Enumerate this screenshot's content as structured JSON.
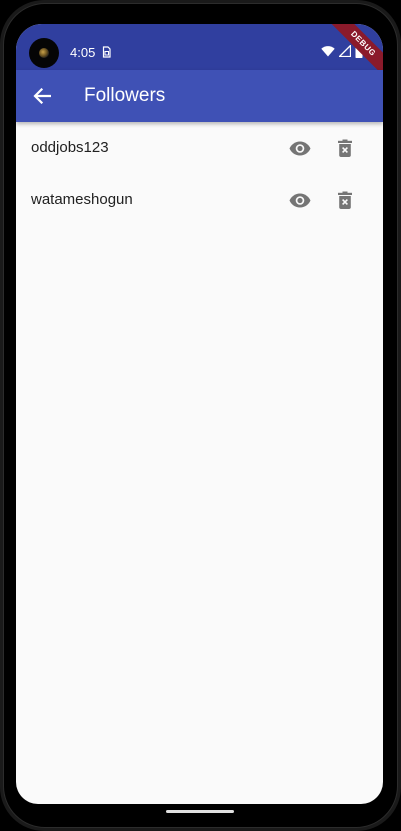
{
  "status_bar": {
    "time": "4:05",
    "background": "#303f9f"
  },
  "debug_banner": {
    "label": "DEBUG",
    "color": "#8b1a2b"
  },
  "app_bar": {
    "title": "Followers",
    "back_icon": "arrow-back-icon",
    "background": "#3f51b5"
  },
  "followers": [
    {
      "username": "oddjobs123",
      "view_icon": "eye-icon",
      "delete_icon": "delete-forever-icon"
    },
    {
      "username": "watameshogun",
      "view_icon": "eye-icon",
      "delete_icon": "delete-forever-icon"
    }
  ],
  "colors": {
    "list_background": "#fafafa",
    "text_primary": "#212121",
    "icon_grey": "#757575"
  }
}
